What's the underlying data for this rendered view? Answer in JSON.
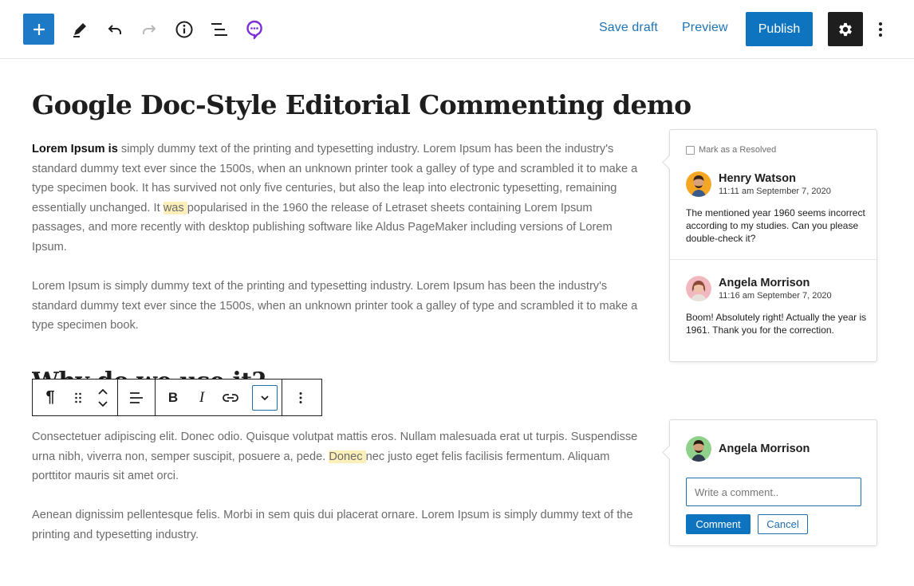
{
  "header": {
    "icons": [
      "plus-icon",
      "pencil-icon",
      "undo-icon",
      "redo-icon",
      "info-icon",
      "list-view-icon",
      "comment-bubble-icon",
      "gear-icon",
      "more-vertical-icon"
    ],
    "save_draft_label": "Save draft",
    "preview_label": "Preview",
    "publish_label": "Publish"
  },
  "post": {
    "title": "Google Doc-Style Editorial Commenting demo",
    "paragraph1": {
      "bold_lead": "Lorem Ipsum is",
      "text_before_highlight": " simply dummy text of the printing and typesetting industry. Lorem Ipsum has been the industry's standard dummy text ever since the 1500s, when an unknown printer took a galley of type and scrambled it to make a type specimen book. It has survived not only five centuries, but also the leap into electronic typesetting, remaining essentially unchanged. It ",
      "highlight": "was ",
      "text_after_highlight": "popularised in the 1960 the release of Letraset sheets containing Lorem Ipsum passages, and more recently with desktop publishing software like Aldus PageMaker including versions of Lorem Ipsum."
    },
    "paragraph2": "Lorem Ipsum is simply dummy text of the printing and typesetting industry. Lorem Ipsum has been the industry's standard dummy text ever since the 1500s, when an unknown printer took a galley of type and scrambled it to make a type specimen book.",
    "hidden_heading": "Why do we use it?",
    "paragraph3": {
      "text_before_highlight": "Consectetuer adipiscing elit. Donec odio. Quisque volutpat mattis eros. Nullam malesuada erat ut turpis. Suspendisse urna nibh, viverra non, semper suscipit, posuere a, pede. ",
      "highlight": "Donec ",
      "text_after_highlight": "nec justo eget felis facilisis fermentum. Aliquam porttitor mauris sit amet orci."
    },
    "paragraph4": "Aenean dignissim pellentesque felis. Morbi in sem quis dui placerat ornare. Lorem Ipsum is simply dummy text of the printing and typesetting industry."
  },
  "block_toolbar": {
    "icons": [
      "paragraph-icon",
      "drag-handle-icon",
      "move-up-down-icon",
      "align-left-icon",
      "bold-icon",
      "italic-icon",
      "link-icon",
      "chevron-down-icon",
      "more-vertical-icon"
    ],
    "bold_glyph": "B",
    "italic_glyph": "I",
    "paragraph_glyph": "¶"
  },
  "comment_board_1": {
    "resolve_label": "Mark as a Resolved",
    "comments": [
      {
        "author": "Henry Watson",
        "time": "11:11 am September 7, 2020",
        "text": "The mentioned year 1960 seems incorrect according to my studies. Can you please double-check it?",
        "avatar_color": "#f5a623"
      },
      {
        "author": "Angela Morrison",
        "time": "11:16 am September 7, 2020",
        "text": "Boom! Absolutely right! Actually the year is 1961. Thank you for the correction.",
        "avatar_color": "#f2b8bf"
      }
    ]
  },
  "comment_board_2": {
    "author": "Angela Morrison",
    "avatar_color": "#8fd18a",
    "input_placeholder": "Write a comment..",
    "comment_button": "Comment",
    "cancel_button": "Cancel"
  },
  "colors": {
    "accent": "#0f74bf",
    "highlight": "#fdefb9",
    "dark": "#1e1e1e",
    "plugin_icon": "#7b2fd6"
  }
}
